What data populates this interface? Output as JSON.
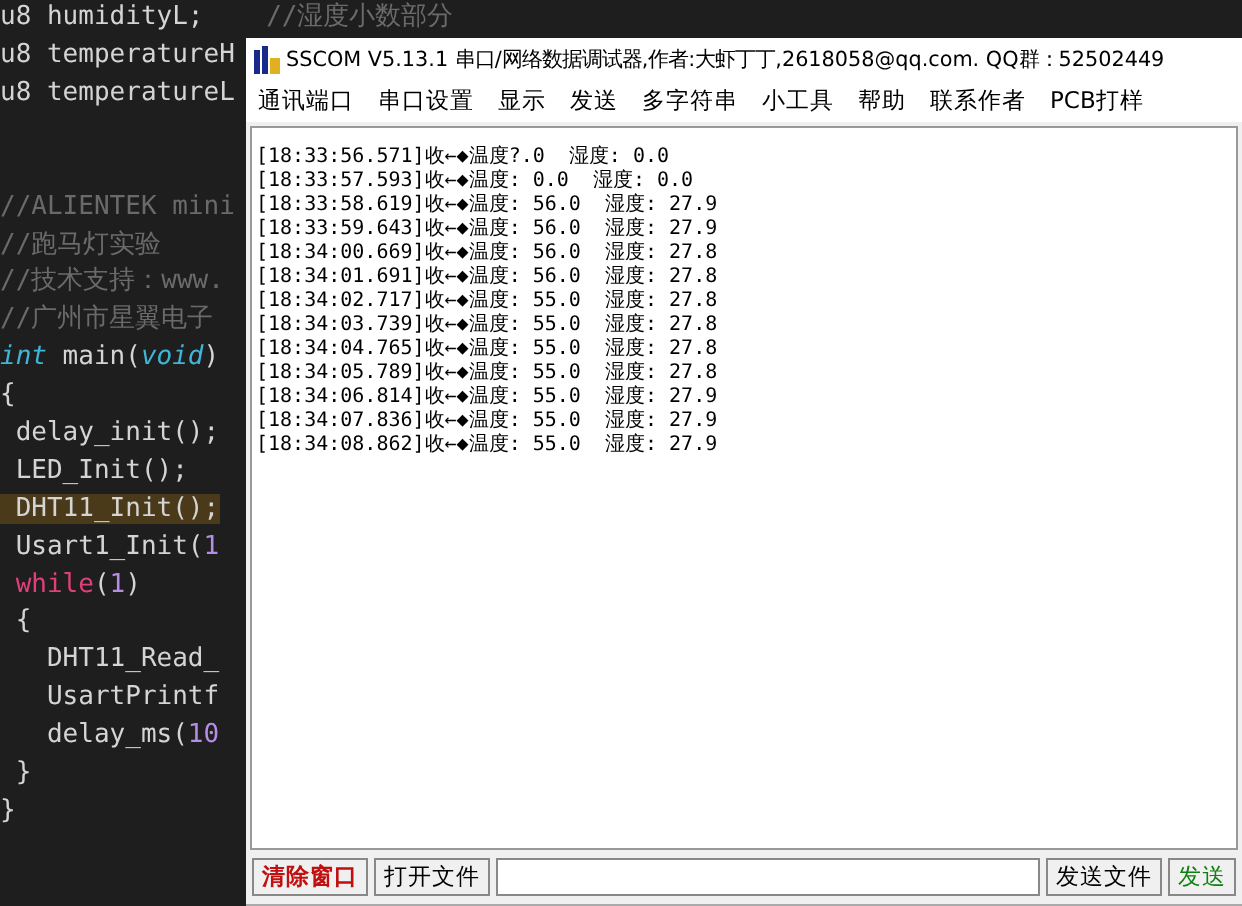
{
  "editor": {
    "declarations": [
      {
        "tokens": [
          {
            "text": "u8 humidityL;    ",
            "kind": "plain"
          },
          {
            "text": "//湿度小数部分",
            "kind": "comment"
          }
        ]
      },
      {
        "tokens": [
          {
            "text": "u8 temperatureH",
            "kind": "plain"
          }
        ]
      },
      {
        "tokens": [
          {
            "text": "u8 temperatureL",
            "kind": "plain"
          }
        ]
      }
    ],
    "lines": [
      {
        "tokens": [
          {
            "text": "//ALIENTEK mini",
            "kind": "comment"
          }
        ]
      },
      {
        "tokens": [
          {
            "text": "//跑马灯实验",
            "kind": "comment"
          }
        ]
      },
      {
        "tokens": [
          {
            "text": "//技术支持：www.",
            "kind": "comment"
          }
        ]
      },
      {
        "tokens": [
          {
            "text": "//广州市星翼电子",
            "kind": "comment"
          }
        ]
      },
      {
        "tokens": [
          {
            "text": "int",
            "kind": "type"
          },
          {
            "text": " main(",
            "kind": "plain"
          },
          {
            "text": "void",
            "kind": "type"
          },
          {
            "text": ")",
            "kind": "plain"
          }
        ]
      },
      {
        "tokens": [
          {
            "text": "{",
            "kind": "plain"
          }
        ]
      },
      {
        "tokens": [
          {
            "text": " delay_init();",
            "kind": "plain"
          }
        ]
      },
      {
        "tokens": [
          {
            "text": " LED_Init();",
            "kind": "plain"
          }
        ]
      },
      {
        "highlighted": true,
        "tokens": [
          {
            "text": " DHT11_Init();",
            "kind": "plain"
          }
        ]
      },
      {
        "tokens": [
          {
            "text": " Usart1_Init(",
            "kind": "plain"
          },
          {
            "text": "1",
            "kind": "number"
          }
        ]
      },
      {
        "tokens": [
          {
            "text": " while",
            "kind": "keyword"
          },
          {
            "text": "(",
            "kind": "plain"
          },
          {
            "text": "1",
            "kind": "number"
          },
          {
            "text": ")",
            "kind": "plain"
          }
        ]
      },
      {
        "tokens": [
          {
            "text": " {",
            "kind": "plain"
          }
        ]
      },
      {
        "tokens": [
          {
            "text": "   DHT11_Read_",
            "kind": "plain"
          }
        ]
      },
      {
        "tokens": [
          {
            "text": "   UsartPrintf",
            "kind": "plain"
          }
        ]
      },
      {
        "tokens": [
          {
            "text": "   delay_ms(",
            "kind": "plain"
          },
          {
            "text": "10",
            "kind": "number"
          }
        ]
      },
      {
        "tokens": [
          {
            "text": " }",
            "kind": "plain"
          }
        ]
      },
      {
        "tokens": [
          {
            "text": "}",
            "kind": "plain"
          }
        ]
      }
    ]
  },
  "window": {
    "title": "SSCOM V5.13.1 串口/网络数据调试器,作者:大虾丁丁,2618058@qq.com. QQ群：52502449",
    "menu": [
      "通讯端口",
      "串口设置",
      "显示",
      "发送",
      "多字符串",
      "小工具",
      "帮助",
      "联系作者",
      "PCB打样"
    ],
    "log": [
      "[18:33:56.571]收←◆温度?.0  湿度: 0.0",
      "[18:33:57.593]收←◆温度: 0.0  湿度: 0.0",
      "[18:33:58.619]收←◆温度: 56.0  湿度: 27.9",
      "[18:33:59.643]收←◆温度: 56.0  湿度: 27.9",
      "[18:34:00.669]收←◆温度: 56.0  湿度: 27.8",
      "[18:34:01.691]收←◆温度: 56.0  湿度: 27.8",
      "[18:34:02.717]收←◆温度: 55.0  湿度: 27.8",
      "[18:34:03.739]收←◆温度: 55.0  湿度: 27.8",
      "[18:34:04.765]收←◆温度: 55.0  湿度: 27.8",
      "[18:34:05.789]收←◆温度: 55.0  湿度: 27.8",
      "[18:34:06.814]收←◆温度: 55.0  湿度: 27.9",
      "[18:34:07.836]收←◆温度: 55.0  湿度: 27.9",
      "[18:34:08.862]收←◆温度: 55.0  湿度: 27.9"
    ],
    "buttons": [
      {
        "label": "清除窗口",
        "kind": "danger"
      },
      {
        "label": "打开文件",
        "kind": "normal"
      }
    ],
    "right_buttons": [
      {
        "label": "发送文件",
        "kind": "normal"
      },
      {
        "label": "发送",
        "kind": "go"
      }
    ]
  }
}
